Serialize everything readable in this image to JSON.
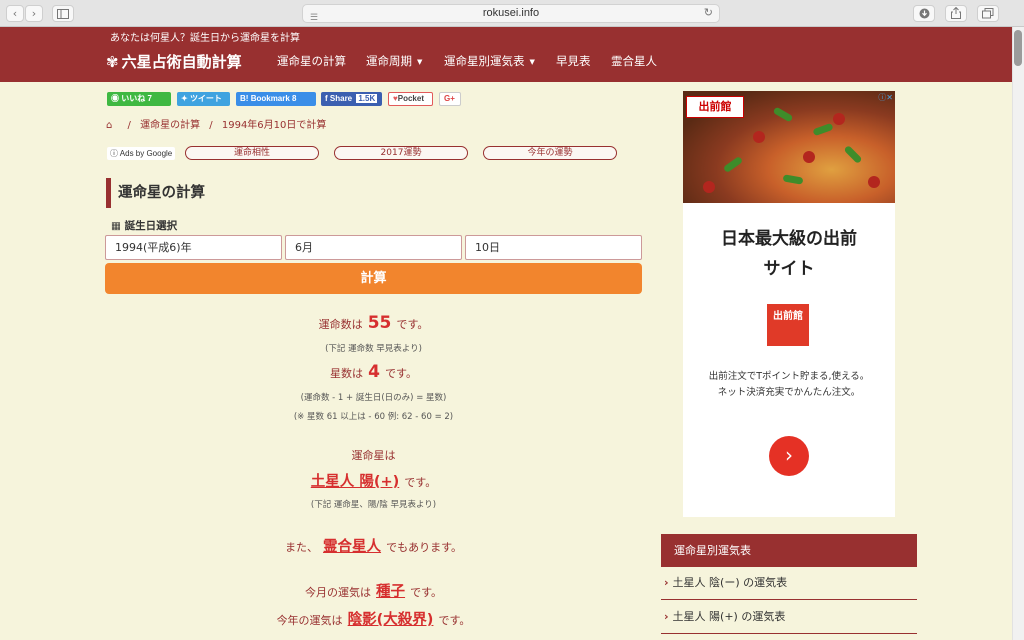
{
  "browser": {
    "url": "rokusei.info",
    "back": "‹",
    "forward": "›"
  },
  "site": {
    "tagline": "あなたは何星人？誕生日から運命星を計算",
    "logo": "六星占術自動計算",
    "nav": [
      "運命星の計算",
      "運命周期",
      "運命星別運気表",
      "早見表",
      "霊合星人"
    ]
  },
  "social": {
    "line": "いいね 7",
    "tweet": "ツイート",
    "bookmark": "Bookmark",
    "bookmark_prefix": "B!",
    "bookmark_suffix": "8",
    "share": "Share",
    "share_count": "1.5K",
    "pocket": "Pocket",
    "gplus": "G+"
  },
  "breadcrumb": {
    "items": [
      "運命星の計算",
      "1994年6月10日で計算"
    ]
  },
  "ads_bar": {
    "adsby": "Ads by Google",
    "links": [
      "運命相性",
      "2017運勢",
      "今年の運勢"
    ]
  },
  "calculator": {
    "heading": "運命星の計算",
    "birth_label": "誕生日選択",
    "year": "1994(平成6)年",
    "month": "6月",
    "day": "10日",
    "button": "計算"
  },
  "result": {
    "unmei_prefix": "運命数は",
    "unmei_value": "55",
    "unmei_suffix": "です。",
    "unmei_note": "(下記 運命数 早見表より)",
    "sei_prefix": "星数は",
    "sei_value": "4",
    "sei_suffix": "です。",
    "sei_note1": "(運命数 - 1 + 誕生日(日のみ) = 星数)",
    "sei_note2": "(※ 星数 61 以上は - 60 例: 62 - 60 = 2)",
    "star_label": "運命星は",
    "star_value": "土星人 陽(+)",
    "star_suffix": "です。",
    "star_note": "(下記 運命星、陽/陰 早見表より)",
    "also_prefix": "また、",
    "also_value": "霊合星人",
    "also_suffix": "でもあります。",
    "month_prefix": "今月の運気は",
    "month_value": "種子",
    "month_suffix": "です。",
    "year_prefix": "今年の運気は",
    "year_value": "陰影(大殺界)",
    "year_suffix": "です。"
  },
  "ad": {
    "brand": "出前館",
    "title_line1": "日本最大級の出前",
    "title_line2": "サイト",
    "icon_text": "出前館",
    "text_line1": "出前注文でTポイント貯まる,使える。",
    "text_line2": "ネット決済充実でかんたん注文。",
    "arrow": "›"
  },
  "widget": {
    "heading": "運命星別運気表",
    "items": [
      "土星人 陰(ー) の運気表",
      "土星人 陽(+) の運気表"
    ]
  },
  "colors": {
    "brand": "#983030",
    "accent": "#f2852d",
    "result_red": "#d62f2f",
    "background": "#f6f4dc"
  }
}
